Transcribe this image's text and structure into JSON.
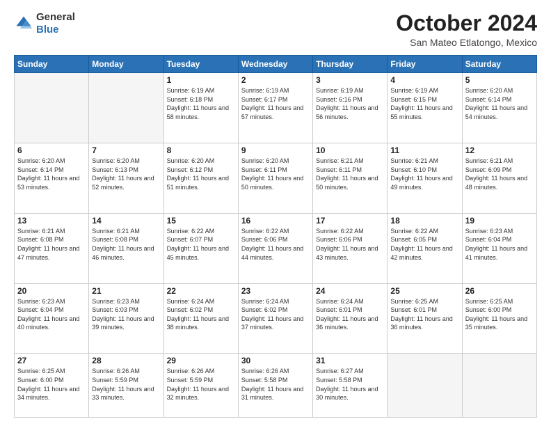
{
  "header": {
    "logo_general": "General",
    "logo_blue": "Blue",
    "month_title": "October 2024",
    "location": "San Mateo Etlatongo, Mexico"
  },
  "days_of_week": [
    "Sunday",
    "Monday",
    "Tuesday",
    "Wednesday",
    "Thursday",
    "Friday",
    "Saturday"
  ],
  "weeks": [
    [
      {
        "day": "",
        "info": ""
      },
      {
        "day": "",
        "info": ""
      },
      {
        "day": "1",
        "info": "Sunrise: 6:19 AM\nSunset: 6:18 PM\nDaylight: 11 hours and 58 minutes."
      },
      {
        "day": "2",
        "info": "Sunrise: 6:19 AM\nSunset: 6:17 PM\nDaylight: 11 hours and 57 minutes."
      },
      {
        "day": "3",
        "info": "Sunrise: 6:19 AM\nSunset: 6:16 PM\nDaylight: 11 hours and 56 minutes."
      },
      {
        "day": "4",
        "info": "Sunrise: 6:19 AM\nSunset: 6:15 PM\nDaylight: 11 hours and 55 minutes."
      },
      {
        "day": "5",
        "info": "Sunrise: 6:20 AM\nSunset: 6:14 PM\nDaylight: 11 hours and 54 minutes."
      }
    ],
    [
      {
        "day": "6",
        "info": "Sunrise: 6:20 AM\nSunset: 6:14 PM\nDaylight: 11 hours and 53 minutes."
      },
      {
        "day": "7",
        "info": "Sunrise: 6:20 AM\nSunset: 6:13 PM\nDaylight: 11 hours and 52 minutes."
      },
      {
        "day": "8",
        "info": "Sunrise: 6:20 AM\nSunset: 6:12 PM\nDaylight: 11 hours and 51 minutes."
      },
      {
        "day": "9",
        "info": "Sunrise: 6:20 AM\nSunset: 6:11 PM\nDaylight: 11 hours and 50 minutes."
      },
      {
        "day": "10",
        "info": "Sunrise: 6:21 AM\nSunset: 6:11 PM\nDaylight: 11 hours and 50 minutes."
      },
      {
        "day": "11",
        "info": "Sunrise: 6:21 AM\nSunset: 6:10 PM\nDaylight: 11 hours and 49 minutes."
      },
      {
        "day": "12",
        "info": "Sunrise: 6:21 AM\nSunset: 6:09 PM\nDaylight: 11 hours and 48 minutes."
      }
    ],
    [
      {
        "day": "13",
        "info": "Sunrise: 6:21 AM\nSunset: 6:08 PM\nDaylight: 11 hours and 47 minutes."
      },
      {
        "day": "14",
        "info": "Sunrise: 6:21 AM\nSunset: 6:08 PM\nDaylight: 11 hours and 46 minutes."
      },
      {
        "day": "15",
        "info": "Sunrise: 6:22 AM\nSunset: 6:07 PM\nDaylight: 11 hours and 45 minutes."
      },
      {
        "day": "16",
        "info": "Sunrise: 6:22 AM\nSunset: 6:06 PM\nDaylight: 11 hours and 44 minutes."
      },
      {
        "day": "17",
        "info": "Sunrise: 6:22 AM\nSunset: 6:06 PM\nDaylight: 11 hours and 43 minutes."
      },
      {
        "day": "18",
        "info": "Sunrise: 6:22 AM\nSunset: 6:05 PM\nDaylight: 11 hours and 42 minutes."
      },
      {
        "day": "19",
        "info": "Sunrise: 6:23 AM\nSunset: 6:04 PM\nDaylight: 11 hours and 41 minutes."
      }
    ],
    [
      {
        "day": "20",
        "info": "Sunrise: 6:23 AM\nSunset: 6:04 PM\nDaylight: 11 hours and 40 minutes."
      },
      {
        "day": "21",
        "info": "Sunrise: 6:23 AM\nSunset: 6:03 PM\nDaylight: 11 hours and 39 minutes."
      },
      {
        "day": "22",
        "info": "Sunrise: 6:24 AM\nSunset: 6:02 PM\nDaylight: 11 hours and 38 minutes."
      },
      {
        "day": "23",
        "info": "Sunrise: 6:24 AM\nSunset: 6:02 PM\nDaylight: 11 hours and 37 minutes."
      },
      {
        "day": "24",
        "info": "Sunrise: 6:24 AM\nSunset: 6:01 PM\nDaylight: 11 hours and 36 minutes."
      },
      {
        "day": "25",
        "info": "Sunrise: 6:25 AM\nSunset: 6:01 PM\nDaylight: 11 hours and 36 minutes."
      },
      {
        "day": "26",
        "info": "Sunrise: 6:25 AM\nSunset: 6:00 PM\nDaylight: 11 hours and 35 minutes."
      }
    ],
    [
      {
        "day": "27",
        "info": "Sunrise: 6:25 AM\nSunset: 6:00 PM\nDaylight: 11 hours and 34 minutes."
      },
      {
        "day": "28",
        "info": "Sunrise: 6:26 AM\nSunset: 5:59 PM\nDaylight: 11 hours and 33 minutes."
      },
      {
        "day": "29",
        "info": "Sunrise: 6:26 AM\nSunset: 5:59 PM\nDaylight: 11 hours and 32 minutes."
      },
      {
        "day": "30",
        "info": "Sunrise: 6:26 AM\nSunset: 5:58 PM\nDaylight: 11 hours and 31 minutes."
      },
      {
        "day": "31",
        "info": "Sunrise: 6:27 AM\nSunset: 5:58 PM\nDaylight: 11 hours and 30 minutes."
      },
      {
        "day": "",
        "info": ""
      },
      {
        "day": "",
        "info": ""
      }
    ]
  ]
}
